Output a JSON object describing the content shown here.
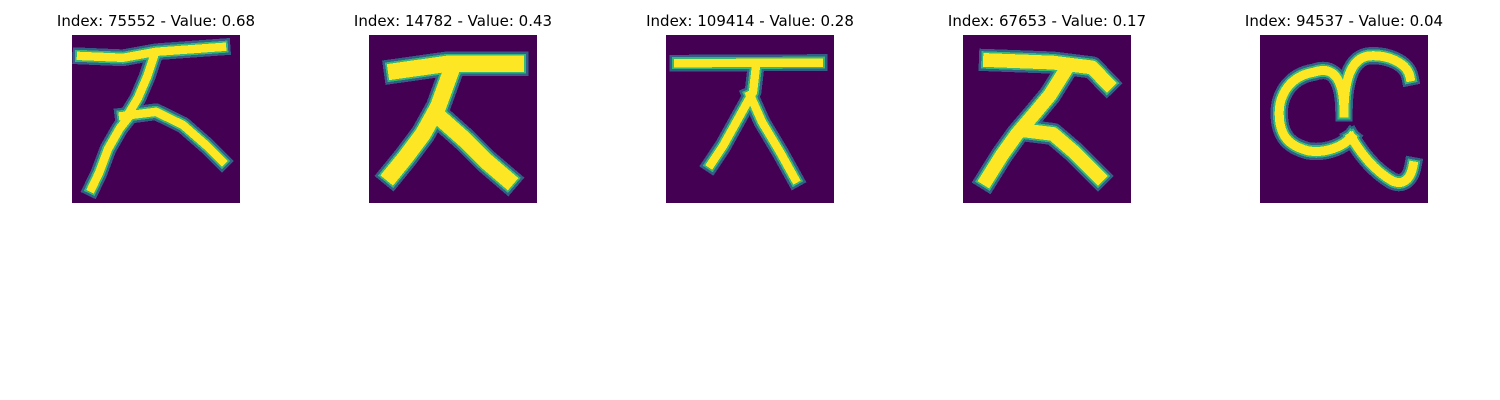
{
  "chart_data": {
    "type": "heatmap",
    "colormap": "viridis",
    "grid": false,
    "panels": [
      {
        "title": "Index: 75552 - Value: 0.68",
        "index": 75552,
        "value": 0.68,
        "glyph": "tilted-tree"
      },
      {
        "title": "Index: 14782 - Value: 0.43",
        "index": 14782,
        "value": 0.43,
        "glyph": "bold-tree"
      },
      {
        "title": "Index: 109414 - Value: 0.28",
        "index": 109414,
        "value": 0.28,
        "glyph": "thin-tree"
      },
      {
        "title": "Index: 67653 - Value: 0.17",
        "index": 67653,
        "value": 0.17,
        "glyph": "slanted-tree"
      },
      {
        "title": "Index: 94537 - Value: 0.04",
        "index": 94537,
        "value": 0.04,
        "glyph": "alpha-c"
      }
    ]
  },
  "colors": {
    "background": "#440154",
    "stroke_core": "#fde725",
    "stroke_edge": "#35b779",
    "stroke_halo": "#31688e"
  }
}
